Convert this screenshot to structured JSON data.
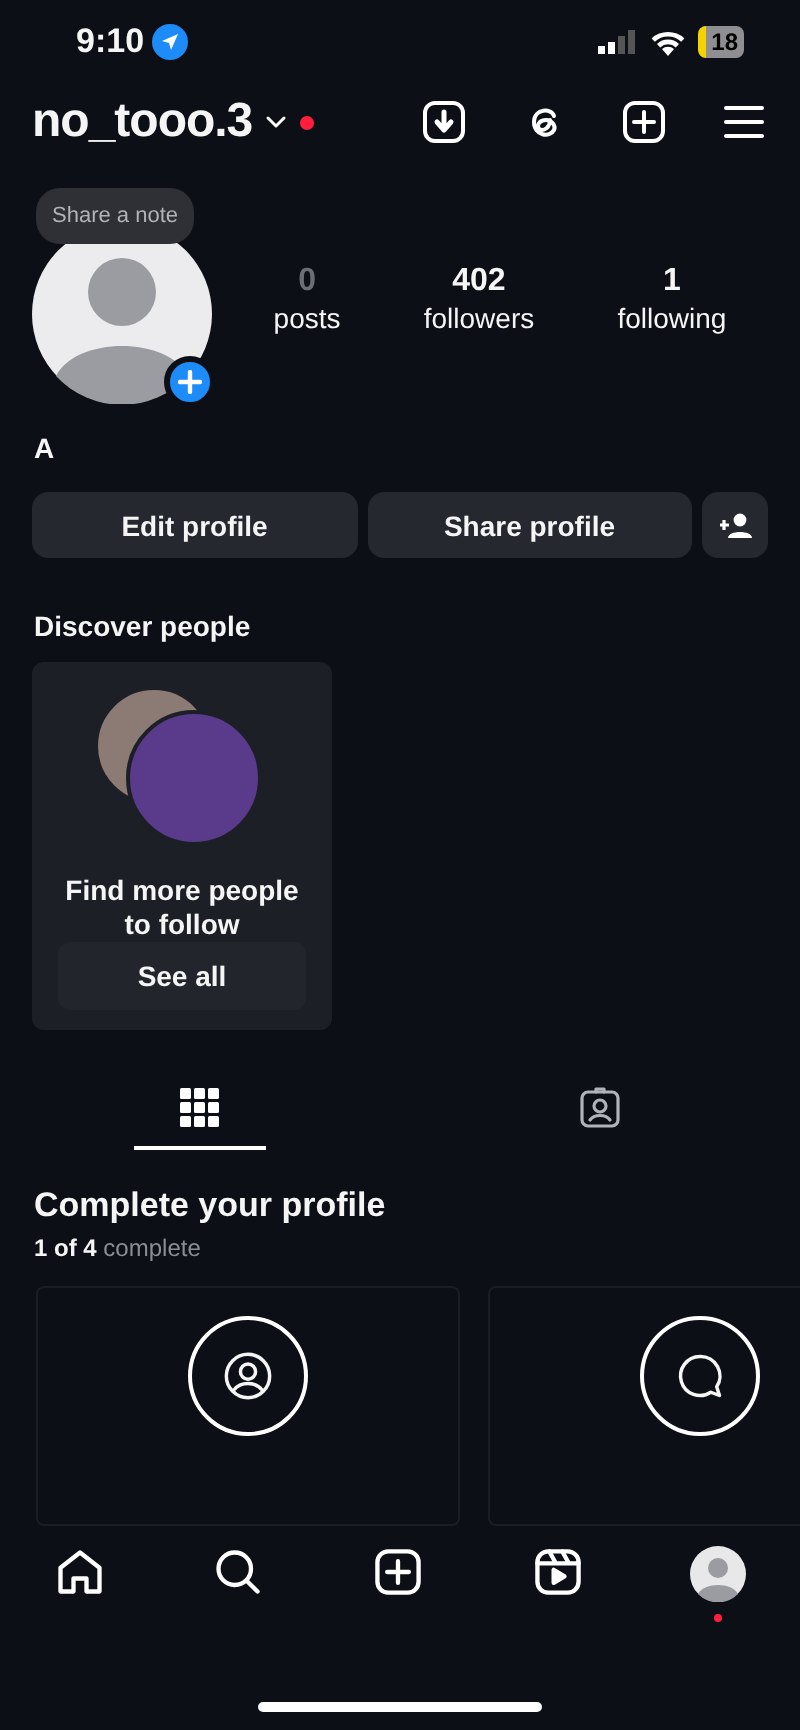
{
  "status_bar": {
    "time": "9:10",
    "battery": "18"
  },
  "header": {
    "username": "no_tooo.3",
    "notification": true
  },
  "note": {
    "text": "Share a note"
  },
  "stats": [
    {
      "value": "0",
      "label": "posts",
      "disabled": true
    },
    {
      "value": "402",
      "label": "followers",
      "disabled": false
    },
    {
      "value": "1",
      "label": "following",
      "disabled": false
    }
  ],
  "display_name": "A",
  "buttons": [
    "Edit profile",
    "Share profile"
  ],
  "discover": {
    "title": "Discover people",
    "card_text": "Find more people to follow",
    "button": "See all"
  },
  "tabs": [
    {
      "kind": "grid",
      "selected": true
    },
    {
      "kind": "tagged",
      "selected": false
    }
  ],
  "complete": {
    "title": "Complete your profile",
    "progress": "**1 of 4** complete",
    "cards": [
      {
        "kind": "photo"
      },
      {
        "kind": "bio"
      }
    ]
  },
  "nav": [
    {
      "kind": "home",
      "notification": false
    },
    {
      "kind": "search",
      "notification": false
    },
    {
      "kind": "create",
      "notification": false
    },
    {
      "kind": "reels",
      "notification": false
    },
    {
      "kind": "profile",
      "notification": true
    }
  ]
}
